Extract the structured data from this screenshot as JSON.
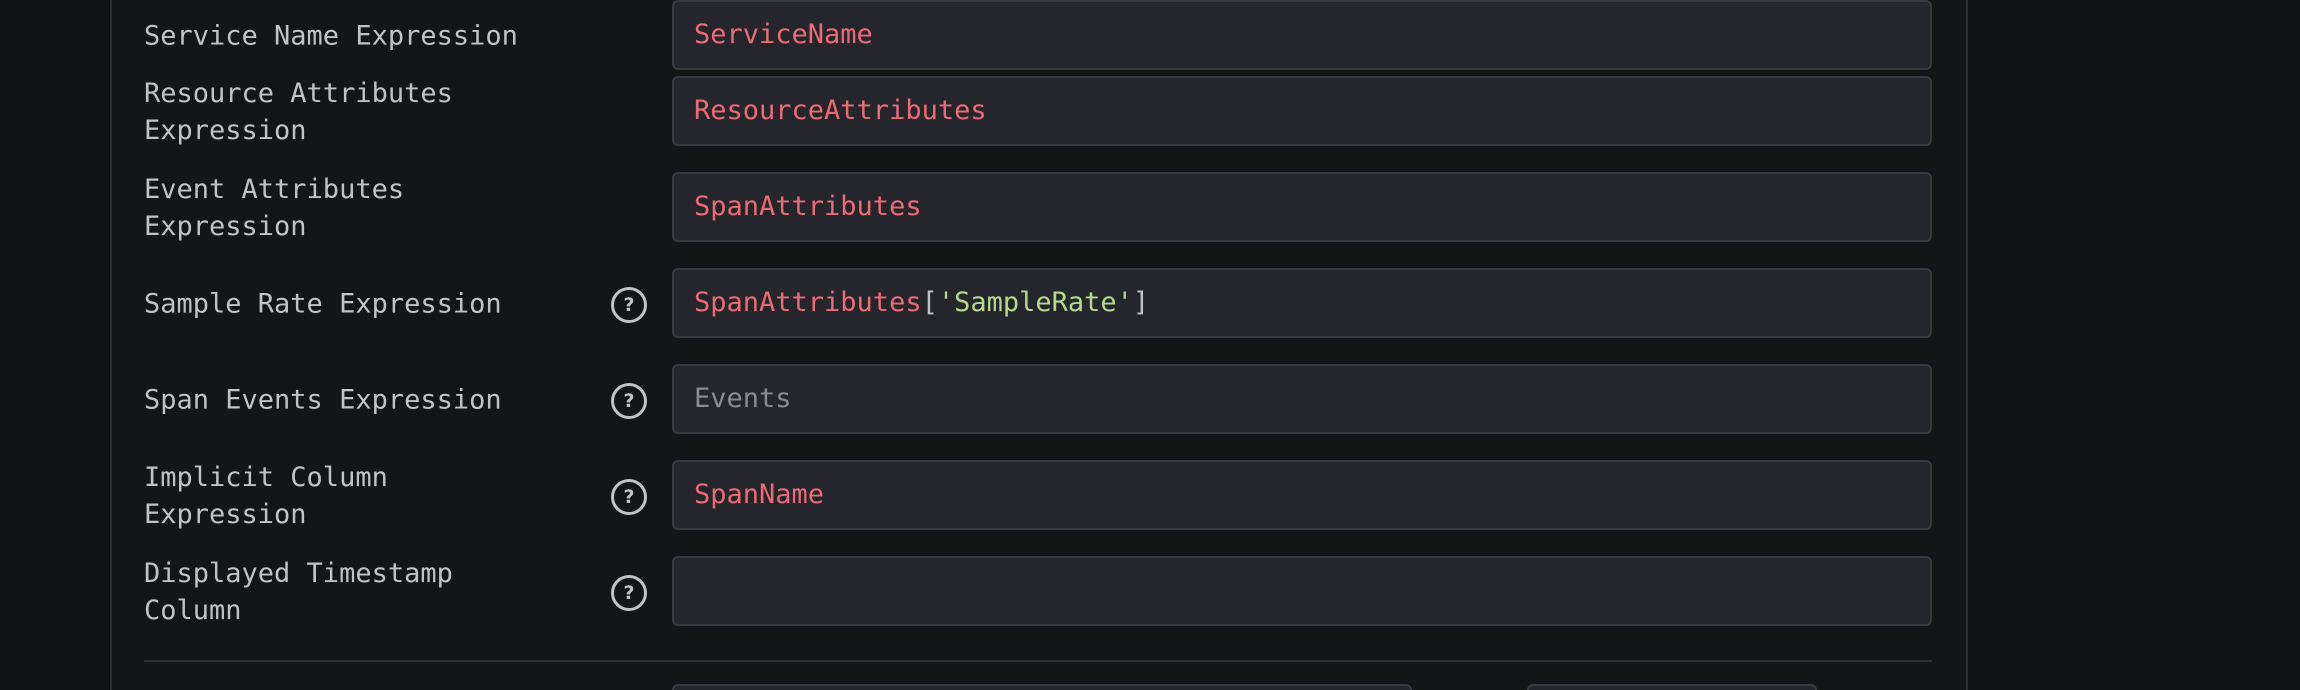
{
  "fields": [
    {
      "label": "Service Name Expression",
      "has_help": false,
      "tokens": [
        {
          "type": "id",
          "text": "ServiceName"
        }
      ]
    },
    {
      "label": "Resource Attributes Expression",
      "has_help": false,
      "tokens": [
        {
          "type": "id",
          "text": "ResourceAttributes"
        }
      ]
    },
    {
      "label": "Event Attributes Expression",
      "has_help": false,
      "tokens": [
        {
          "type": "id",
          "text": "SpanAttributes"
        }
      ]
    },
    {
      "label": "Sample Rate Expression",
      "has_help": true,
      "tokens": [
        {
          "type": "id",
          "text": "SpanAttributes"
        },
        {
          "type": "punc",
          "text": "["
        },
        {
          "type": "str",
          "text": "'SampleRate'"
        },
        {
          "type": "punc",
          "text": "]"
        }
      ]
    },
    {
      "label": "Span Events Expression",
      "has_help": true,
      "tokens": [],
      "placeholder": "Events"
    },
    {
      "label": "Implicit Column Expression",
      "has_help": true,
      "tokens": [
        {
          "type": "id",
          "text": "SpanName"
        }
      ]
    },
    {
      "label": "Displayed Timestamp Column",
      "has_help": true,
      "tokens": []
    }
  ],
  "help_glyph": "?",
  "icons": {
    "help": "question-circle-icon"
  },
  "colors": {
    "identifier": "#ec6a76",
    "string": "#b3d98c",
    "punctuation": "#c1c2c5",
    "placeholder": "#8a8c92"
  }
}
